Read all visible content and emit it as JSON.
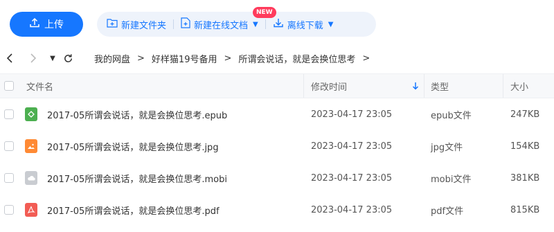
{
  "toolbar": {
    "upload_label": "上传",
    "new_folder_label": "新建文件夹",
    "new_online_doc_label": "新建在线文档",
    "new_badge": "NEW",
    "offline_download_label": "离线下载",
    "accent_color": "#1677ff"
  },
  "breadcrumb": {
    "items": [
      "我的网盘",
      "好样猫19号备用",
      "所谓会说话，就是会换位思考"
    ],
    "separator": ">"
  },
  "table": {
    "headers": {
      "name": "文件名",
      "modified": "修改时间",
      "type": "类型",
      "size": "大小"
    },
    "rows": [
      {
        "name": "2017-05所谓会说话，就是会换位思考.epub",
        "modified": "2023-04-17 23:05",
        "type": "epub文件",
        "size": "247KB",
        "icon": "epub-icon",
        "icon_color": "#4caf50"
      },
      {
        "name": "2017-05所谓会说话，就是会换位思考.jpg",
        "modified": "2023-04-17 23:05",
        "type": "jpg文件",
        "size": "154KB",
        "icon": "image-icon",
        "icon_color": "#ff8a34"
      },
      {
        "name": "2017-05所谓会说话，就是会换位思考.mobi",
        "modified": "2023-04-17 23:05",
        "type": "mobi文件",
        "size": "381KB",
        "icon": "cloud-file-icon",
        "icon_color": "#c9ccd1"
      },
      {
        "name": "2017-05所谓会说话，就是会换位思考.pdf",
        "modified": "2023-04-17 23:05",
        "type": "pdf文件",
        "size": "815KB",
        "icon": "pdf-icon",
        "icon_color": "#f25c54"
      }
    ]
  }
}
